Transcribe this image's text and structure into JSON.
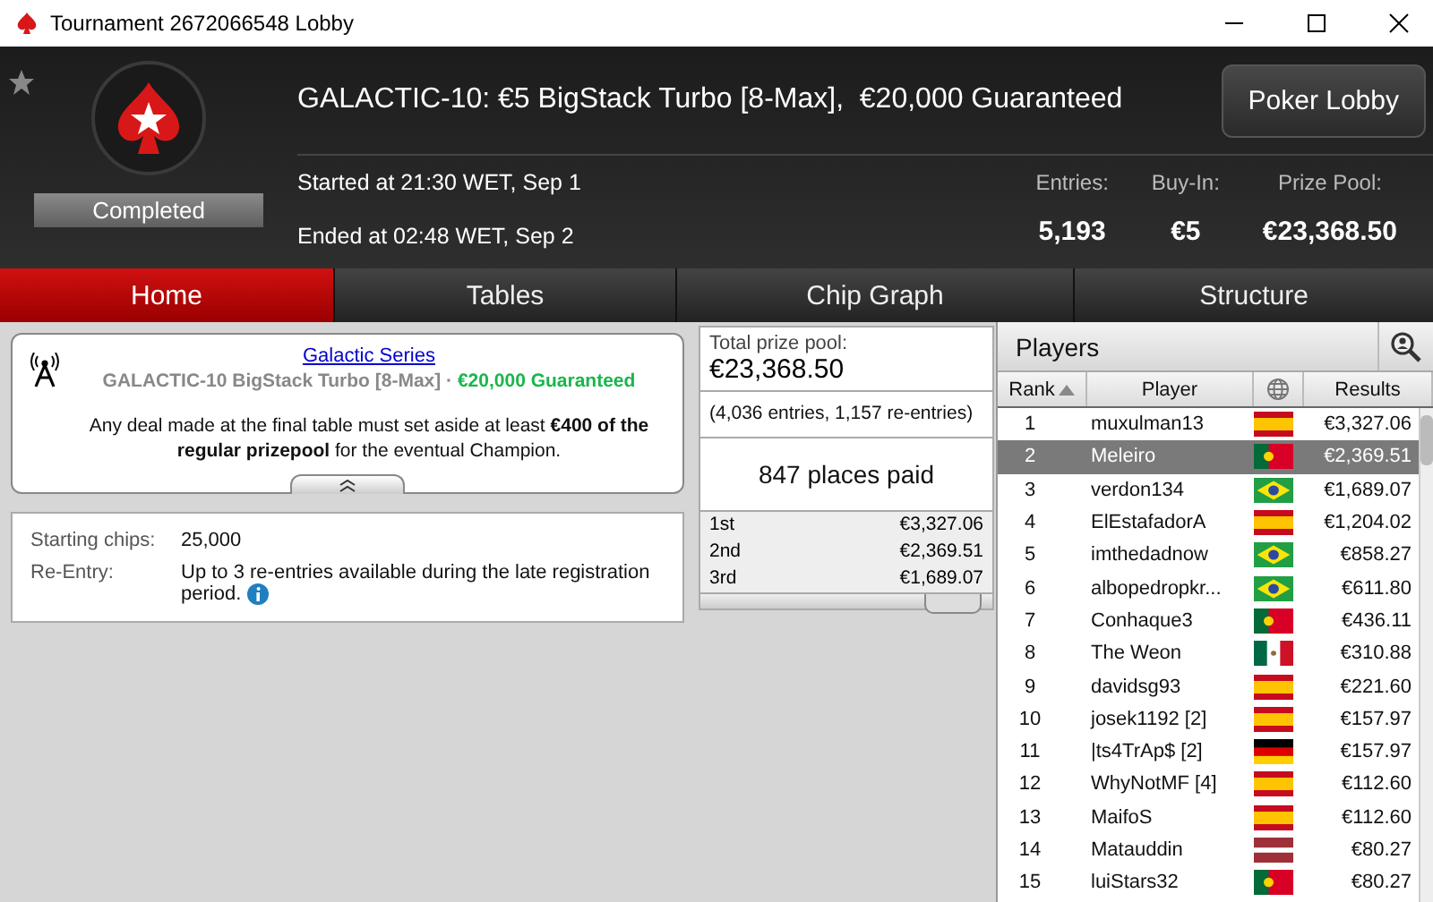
{
  "window": {
    "title": "Tournament 2672066548 Lobby"
  },
  "header": {
    "title": "GALACTIC-10: €5 BigStack Turbo [8-Max],  €20,000 Guaranteed",
    "status": "Completed",
    "favorite": false,
    "button": "Poker Lobby",
    "started": "Started at 21:30 WET, Sep 1",
    "ended": "Ended at 02:48 WET, Sep 2",
    "stats": [
      {
        "label": "Entries:",
        "value": "5,193"
      },
      {
        "label": "Buy-In:",
        "value": "€5"
      },
      {
        "label": "Prize Pool:",
        "value": "€23,368.50"
      }
    ]
  },
  "tabs": [
    {
      "label": "Home",
      "selected": true
    },
    {
      "label": "Tables",
      "selected": false
    },
    {
      "label": "Chip Graph",
      "selected": false
    },
    {
      "label": "Structure",
      "selected": false
    }
  ],
  "info": {
    "series_link": "Galactic Series",
    "subtitle": "GALACTIC-10 BigStack Turbo [8-Max]",
    "separator": "·",
    "guarantee": "€20,000 Guaranteed",
    "notice": "Any deal made at the final table must set aside at least **€400 of the regular prizepool** for the eventual Champion."
  },
  "details": [
    {
      "label": "Starting chips:",
      "value": "25,000",
      "info": false
    },
    {
      "label": "Re-Entry:",
      "value": "Up to 3 re-entries available during the late registration period.",
      "info": true
    }
  ],
  "prize": {
    "label": "Total prize pool:",
    "total": "€23,368.50",
    "entries": "(4,036 entries, 1,157 re-entries)",
    "places_paid": "847 places paid",
    "places": [
      {
        "place": "1st",
        "amount": "€3,327.06"
      },
      {
        "place": "2nd",
        "amount": "€2,369.51"
      },
      {
        "place": "3rd",
        "amount": "€1,689.07"
      }
    ]
  },
  "players": {
    "title": "Players",
    "columns": [
      "Rank",
      "Player",
      "Results"
    ],
    "rows": [
      {
        "rank": "1",
        "player": "muxulman13",
        "kind": "spain",
        "result": "€3,327.06",
        "selected": false
      },
      {
        "rank": "2",
        "player": "Meleiro",
        "kind": "portugal",
        "result": "€2,369.51",
        "selected": true
      },
      {
        "rank": "3",
        "player": "verdon134",
        "kind": "brazil",
        "result": "€1,689.07",
        "selected": false
      },
      {
        "rank": "4",
        "player": "ElEstafadorA",
        "kind": "spain",
        "result": "€1,204.02",
        "selected": false
      },
      {
        "rank": "5",
        "player": "imthedadnow",
        "kind": "brazil",
        "result": "€858.27",
        "selected": false
      },
      {
        "rank": "6",
        "player": "albopedropkr...",
        "kind": "brazil",
        "result": "€611.80",
        "selected": false
      },
      {
        "rank": "7",
        "player": "Conhaque3",
        "kind": "portugal",
        "result": "€436.11",
        "selected": false
      },
      {
        "rank": "8",
        "player": "The Weon",
        "kind": "mexico",
        "result": "€310.88",
        "selected": false
      },
      {
        "rank": "9",
        "player": "davidsg93",
        "kind": "spain",
        "result": "€221.60",
        "selected": false
      },
      {
        "rank": "10",
        "player": "josek1192 [2]",
        "kind": "spain",
        "result": "€157.97",
        "selected": false
      },
      {
        "rank": "11",
        "player": "|ts4TrAp$ [2]",
        "kind": "germany",
        "result": "€157.97",
        "selected": false
      },
      {
        "rank": "12",
        "player": "WhyNotMF [4]",
        "kind": "spain",
        "result": "€112.60",
        "selected": false
      },
      {
        "rank": "13",
        "player": "MaifoS",
        "kind": "spain",
        "result": "€112.60",
        "selected": false
      },
      {
        "rank": "14",
        "player": "Matauddin",
        "kind": "latvia",
        "result": "€80.27",
        "selected": false
      },
      {
        "rank": "15",
        "player": "luiStars32",
        "kind": "portugal",
        "result": "€80.27",
        "selected": false
      }
    ]
  }
}
